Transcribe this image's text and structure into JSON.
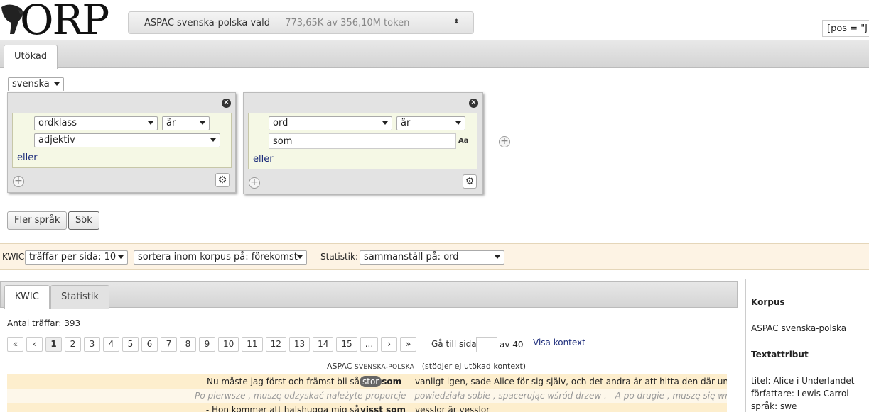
{
  "header": {
    "logo_text": "ORP",
    "corpus_select": {
      "name": "ASPAC svenska-polska vald",
      "stats": " — 773,65K av 356,10M token"
    },
    "cqp_query": "[pos = \"J"
  },
  "search_tabs": {
    "extended": "Utökad"
  },
  "extended": {
    "language": "svenska",
    "tokens": [
      {
        "attribute": "ordklass",
        "operator": "är",
        "value": "adjektiv",
        "or_label": "eller"
      },
      {
        "attribute": "ord",
        "operator": "är",
        "value": "som",
        "case_label": "Aa",
        "or_label": "eller"
      }
    ],
    "more_languages_button": "Fler språk",
    "search_button": "Sök"
  },
  "options": {
    "kwic_label": "KWIC:",
    "hits_per_page": "träffar per sida: 10",
    "sort": "sortera inom korpus på: förekomst",
    "stats_label": "Statistik:",
    "stats_compile": "sammanställ på: ord"
  },
  "results": {
    "tabs": [
      "KWIC",
      "Statistik"
    ],
    "hits_text": "Antal träffar: 393",
    "pager": [
      "«",
      "‹",
      "1",
      "2",
      "3",
      "4",
      "5",
      "6",
      "7",
      "8",
      "9",
      "10",
      "11",
      "12",
      "13",
      "14",
      "15",
      "...",
      "›",
      "»"
    ],
    "active_page": "1",
    "goto_label": "Gå till sida",
    "of_pages": "av 40",
    "show_context": "Visa kontext",
    "corpus_heading": "ASPAC",
    "corpus_heading_sc": "SVENSKA-POLSKA",
    "corpus_note": "(stödjer ej utökad kontext)",
    "rows": [
      {
        "left": "- Nu måste jag först och främst bli så",
        "match_hl": "stor",
        "match_rest": "som",
        "right": "vanligt igen, sade Alice för sig själv, och det andra är att hitta den där underbara"
      },
      {
        "aligned": "- Po pierwsze , muszę odzyskać należyte proporcje - powiedziała sobie , spacerując wśród drzew . - A po drugie , muszę się wreszcz"
      },
      {
        "left": "- Hon kommer att halshugga mig så",
        "match_hl": "",
        "match_rest": "visst som",
        "right": "vesslor är vesslor"
      }
    ]
  },
  "sidebar": {
    "corpus_heading": "Korpus",
    "corpus_name": "ASPAC svenska-polska",
    "text_attr_heading": "Textattribut",
    "title": "titel: Alice i Underlandet",
    "author": "författare: Lewis Carrol",
    "lang": "språk: swe"
  }
}
